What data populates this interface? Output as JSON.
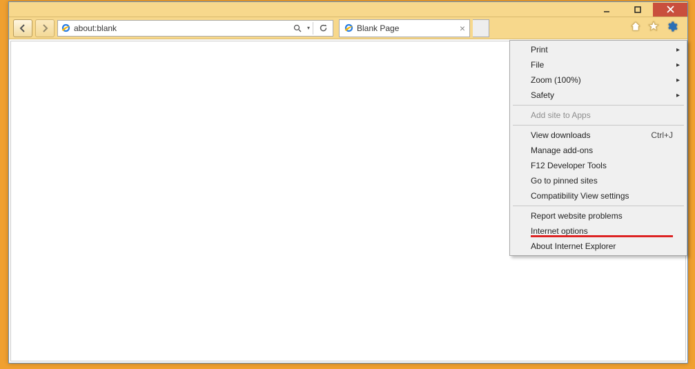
{
  "address_bar": {
    "url": "about:blank"
  },
  "tab": {
    "title": "Blank Page"
  },
  "tools_menu": {
    "print": "Print",
    "file": "File",
    "zoom": "Zoom (100%)",
    "safety": "Safety",
    "add_site": "Add site to Apps",
    "view_downloads": "View downloads",
    "view_downloads_shortcut": "Ctrl+J",
    "manage_addons": "Manage add-ons",
    "f12": "F12 Developer Tools",
    "pinned": "Go to pinned sites",
    "compat": "Compatibility View settings",
    "report": "Report website problems",
    "internet_options": "Internet options",
    "about": "About Internet Explorer"
  }
}
